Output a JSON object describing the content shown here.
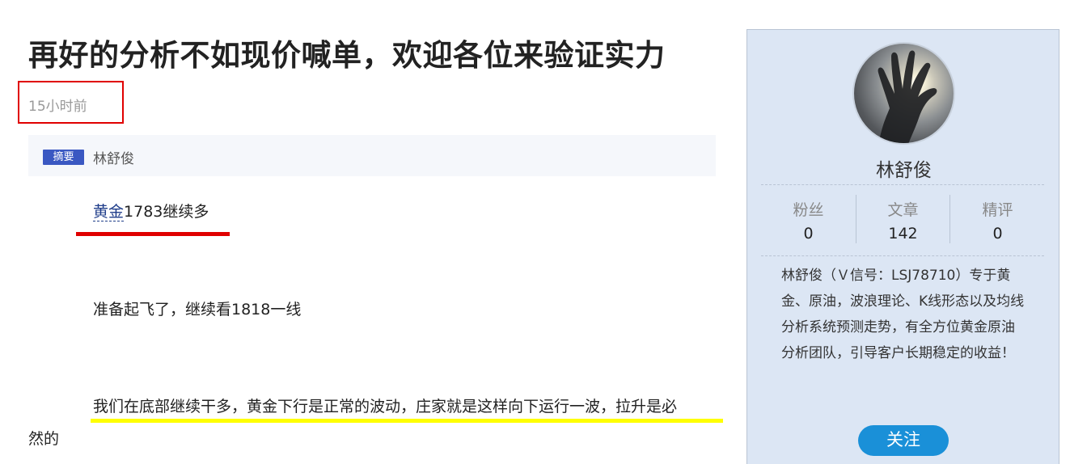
{
  "article": {
    "title": "再好的分析不如现价喊单，欢迎各位来验证实力",
    "time": "15小时前",
    "summary_badge": "摘要",
    "summary_text": "林舒俊",
    "paragraphs": {
      "p1_link": "黄金",
      "p1_rest": "1783继续多",
      "p2": "准备起飞了，继续看1818一线",
      "p3_line1": "我们在底部继续干多，黄金下行是正常的波动，庄家就是这样向下运行一波，拉升是必",
      "p3_line2": "然的"
    }
  },
  "sidebar": {
    "author_name": "林舒俊",
    "stats": [
      {
        "label": "粉丝",
        "value": "0"
      },
      {
        "label": "文章",
        "value": "142"
      },
      {
        "label": "精评",
        "value": "0"
      }
    ],
    "bio": "林舒俊（Ｖ信号：LSJ78710）专于黄金、原油，波浪理论、K线形态以及均线分析系统预测走势，有全方位黄金原油分析团队，引导客户长期稳定的收益！",
    "follow_label": "关注"
  },
  "colors": {
    "accent": "#1a90d8",
    "badge": "#3a58c2",
    "highlight_red": "#e00000",
    "highlight_yellow": "#ffff00",
    "sidebar_bg": "#dce6f4"
  },
  "icons": {
    "avatar": "hand-silhouette-photo"
  }
}
